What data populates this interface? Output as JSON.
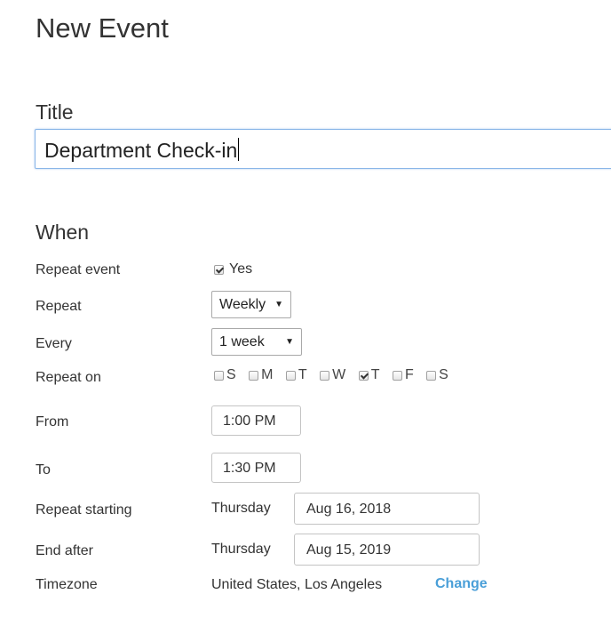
{
  "page": {
    "title": "New Event"
  },
  "title_section": {
    "label": "Title",
    "input_value": "Department Check-in"
  },
  "when_section": {
    "label": "When",
    "repeat_event": {
      "label": "Repeat event",
      "checked": true,
      "option_label": "Yes"
    },
    "repeat": {
      "label": "Repeat",
      "selected": "Weekly",
      "arrow": "▼"
    },
    "every": {
      "label": "Every",
      "selected": "1 week",
      "arrow": "▼"
    },
    "repeat_on": {
      "label": "Repeat on",
      "days": [
        {
          "label": "S",
          "checked": false
        },
        {
          "label": "M",
          "checked": false
        },
        {
          "label": "T",
          "checked": false
        },
        {
          "label": "W",
          "checked": false
        },
        {
          "label": "T",
          "checked": true
        },
        {
          "label": "F",
          "checked": false
        },
        {
          "label": "S",
          "checked": false
        }
      ]
    },
    "from": {
      "label": "From",
      "value": "1:00 PM"
    },
    "to": {
      "label": "To",
      "value": "1:30 PM"
    },
    "repeat_starting": {
      "label": "Repeat starting",
      "weekday": "Thursday",
      "date": "Aug 16, 2018"
    },
    "end_after": {
      "label": "End after",
      "weekday": "Thursday",
      "date": "Aug 15, 2019"
    },
    "timezone": {
      "label": "Timezone",
      "value": "United States, Los Angeles",
      "change_label": "Change"
    }
  },
  "colors": {
    "link": "#4a9fd8",
    "focus_border": "#8ab6e8",
    "text": "#333333"
  }
}
